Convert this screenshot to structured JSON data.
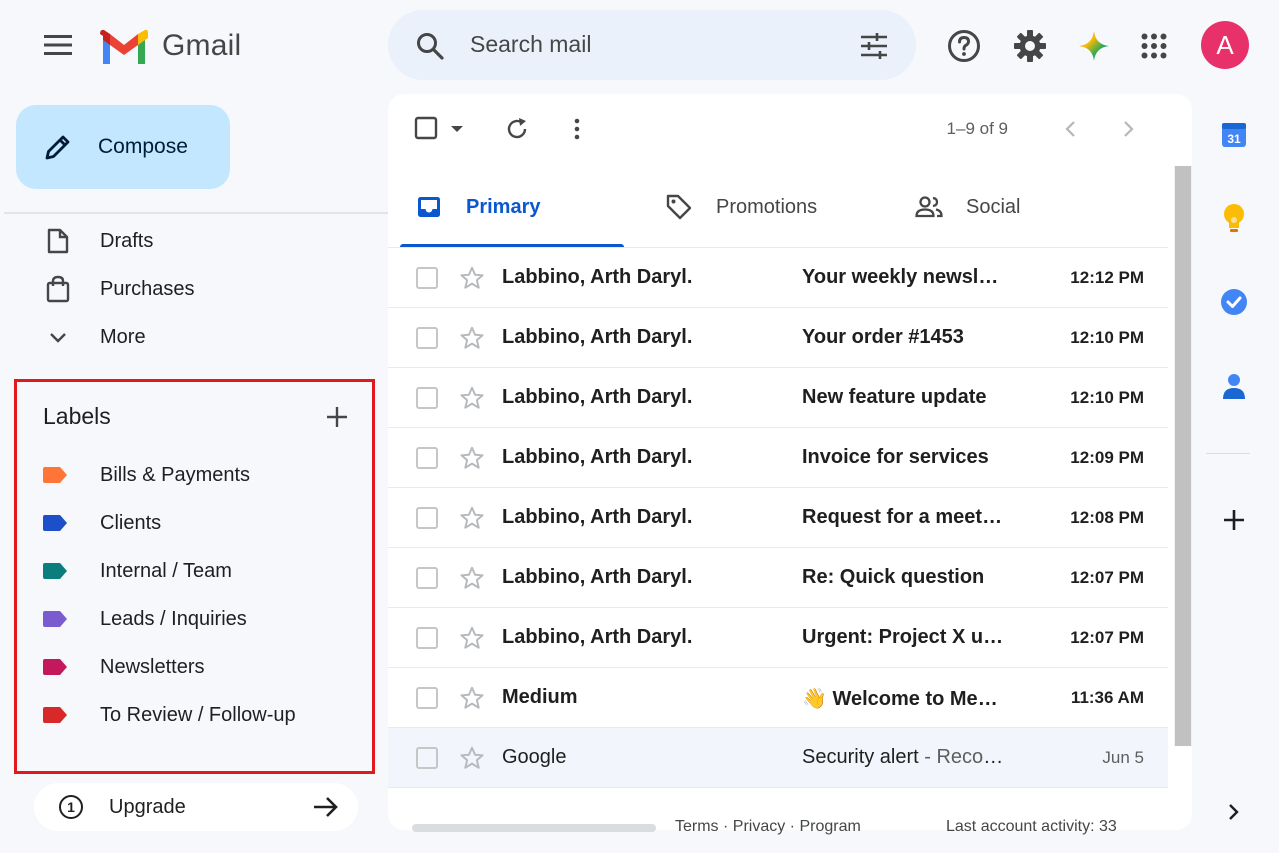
{
  "header": {
    "app_name": "Gmail",
    "search_placeholder": "Search mail",
    "avatar_letter": "A"
  },
  "sidebar": {
    "compose_label": "Compose",
    "nav": [
      {
        "label": "Drafts",
        "icon": "draft-icon"
      },
      {
        "label": "Purchases",
        "icon": "shopping-bag-icon"
      },
      {
        "label": "More",
        "icon": "chevron-down-icon"
      }
    ],
    "labels_title": "Labels",
    "labels": [
      {
        "name": "Bills & Payments",
        "color": "#ff7537"
      },
      {
        "name": "Clients",
        "color": "#1c4fc9"
      },
      {
        "name": "Internal / Team",
        "color": "#0b7d7d"
      },
      {
        "name": "Leads / Inquiries",
        "color": "#7b5bd0"
      },
      {
        "name": "Newsletters",
        "color": "#c4185c"
      },
      {
        "name": "To Review / Follow-up",
        "color": "#d9282a"
      }
    ],
    "upgrade_badge": "1",
    "upgrade_label": "Upgrade"
  },
  "toolbar": {
    "pager": "1–9 of 9"
  },
  "tabs": [
    {
      "label": "Primary",
      "active": true
    },
    {
      "label": "Promotions",
      "active": false
    },
    {
      "label": "Social",
      "active": false
    }
  ],
  "emails": [
    {
      "sender": "Labbino, Arth Daryl.",
      "subject": "Your weekly newsletter",
      "snippet": "",
      "time": "12:12 PM",
      "unread": true
    },
    {
      "sender": "Labbino, Arth Daryl.",
      "subject": "Your order #1453",
      "snippet": "",
      "time": "12:10 PM",
      "unread": true
    },
    {
      "sender": "Labbino, Arth Daryl.",
      "subject": "New feature update",
      "snippet": "",
      "time": "12:10 PM",
      "unread": true
    },
    {
      "sender": "Labbino, Arth Daryl.",
      "subject": "Invoice for services",
      "snippet": "",
      "time": "12:09 PM",
      "unread": true
    },
    {
      "sender": "Labbino, Arth Daryl.",
      "subject": "Request for a meeting",
      "snippet": "",
      "time": "12:08 PM",
      "unread": true
    },
    {
      "sender": "Labbino, Arth Daryl.",
      "subject": "Re: Quick question",
      "snippet": "",
      "time": "12:07 PM",
      "unread": true
    },
    {
      "sender": "Labbino, Arth Daryl.",
      "subject": "Urgent: Project X update",
      "snippet": "",
      "time": "12:07 PM",
      "unread": true
    },
    {
      "sender": "Medium",
      "subject": "👋 Welcome to Medium",
      "snippet": "",
      "time": "11:36 AM",
      "unread": true
    },
    {
      "sender": "Google",
      "subject": "Security alert",
      "snippet": " - Recovery",
      "time": "Jun 5",
      "unread": false
    }
  ],
  "footer": {
    "links": "Terms · Privacy · Program",
    "activity": "Last account activity: 33"
  },
  "side_panel": {
    "calendar_day": "31"
  }
}
